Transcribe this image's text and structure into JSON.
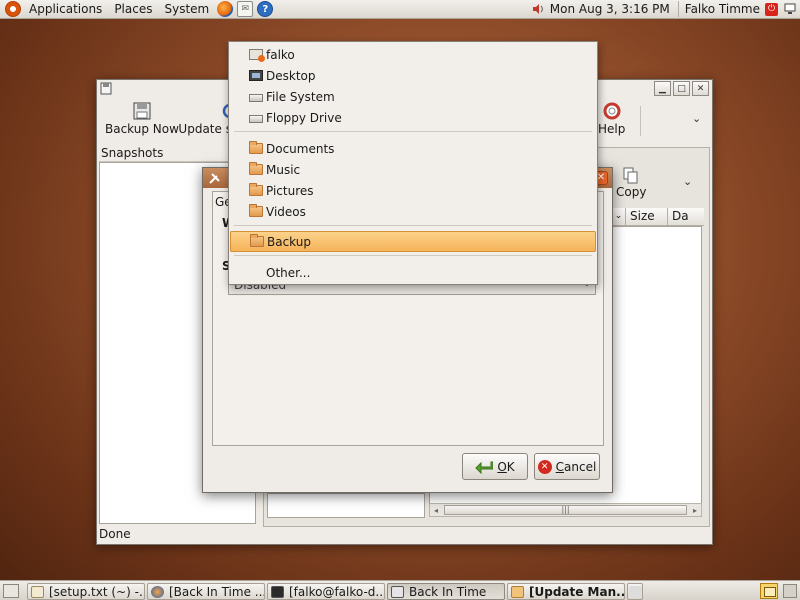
{
  "top_panel": {
    "menus": [
      "Applications",
      "Places",
      "System"
    ],
    "clock": "Mon Aug  3,  3:16 PM",
    "user": "Falko Timme"
  },
  "main_window": {
    "toolbar": {
      "backup_now": "Backup Now",
      "update_snapshots": "Update sn",
      "help": "Help",
      "copy": "Copy"
    },
    "snapshots_header": "Snapshots",
    "columns": [
      "Size",
      "Da"
    ],
    "status": "Done"
  },
  "settings_dialog": {
    "tab_fragment": "Ge",
    "label_fragment_1": "W",
    "label_fragment_2": "S",
    "schedule_value": "Disabled",
    "ok_mnemonic": "O",
    "ok_rest": "K",
    "cancel_mnemonic": "C",
    "cancel_rest": "ancel"
  },
  "places_menu": {
    "items": [
      {
        "label": "falko",
        "icon": "home-folder-icon"
      },
      {
        "label": "Desktop",
        "icon": "desktop-icon"
      },
      {
        "label": "File System",
        "icon": "drive-icon"
      },
      {
        "label": "Floppy Drive",
        "icon": "drive-icon"
      },
      {
        "label": "Documents",
        "icon": "folder-icon"
      },
      {
        "label": "Music",
        "icon": "folder-icon"
      },
      {
        "label": "Pictures",
        "icon": "folder-icon"
      },
      {
        "label": "Videos",
        "icon": "folder-icon"
      },
      {
        "label": "Backup",
        "icon": "folder-icon"
      },
      {
        "label": "Other...",
        "icon": ""
      }
    ],
    "selected_item": "Backup",
    "selection_color": "#f6b35a"
  },
  "taskbar": {
    "tasks": [
      "[setup.txt (~) -...",
      "[Back In Time ...",
      "[falko@falko-d...",
      "Back In Time",
      "[Update Man..."
    ]
  },
  "colors": {
    "desktop_bg": "#94502c",
    "dialog_titlebar": "#a8663a"
  }
}
